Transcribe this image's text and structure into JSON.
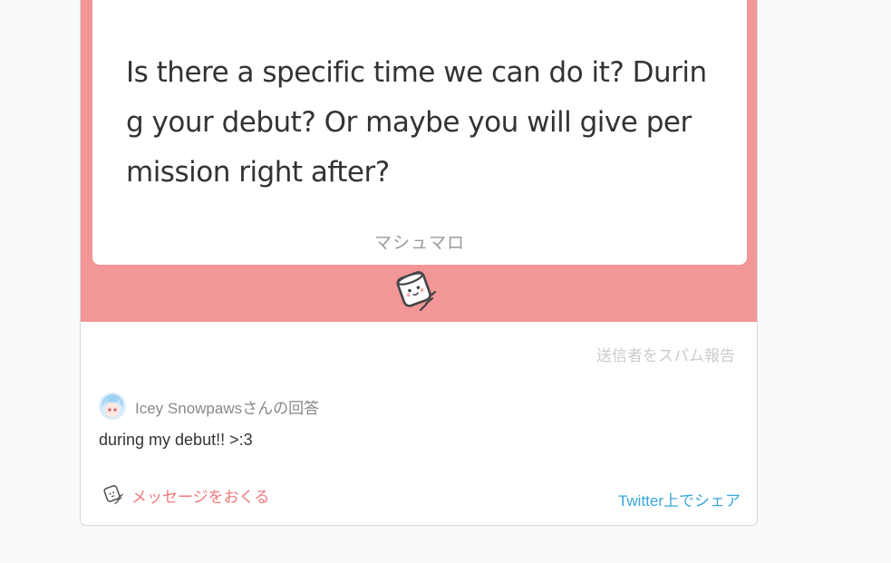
{
  "message": {
    "text": "Is there a specific time we can do it? During your debut? Or maybe you will give permission right after?",
    "brand": "マシュマロ"
  },
  "report_link": "送信者をスパム報告",
  "answer": {
    "label": "Icey Snowpawsさんの回答",
    "text": "during my debut!! >:3"
  },
  "footer": {
    "send_label": "メッセージをおくる",
    "share_label": "Twitter上でシェア"
  },
  "icons": {
    "mascot": "marshmallow-icon",
    "avatar": "avatar",
    "send": "marshmallow-icon"
  },
  "colors": {
    "band": "#f29698",
    "send_link": "#f2787b",
    "share_link": "#3aa6dc",
    "muted": "#cccccc"
  }
}
